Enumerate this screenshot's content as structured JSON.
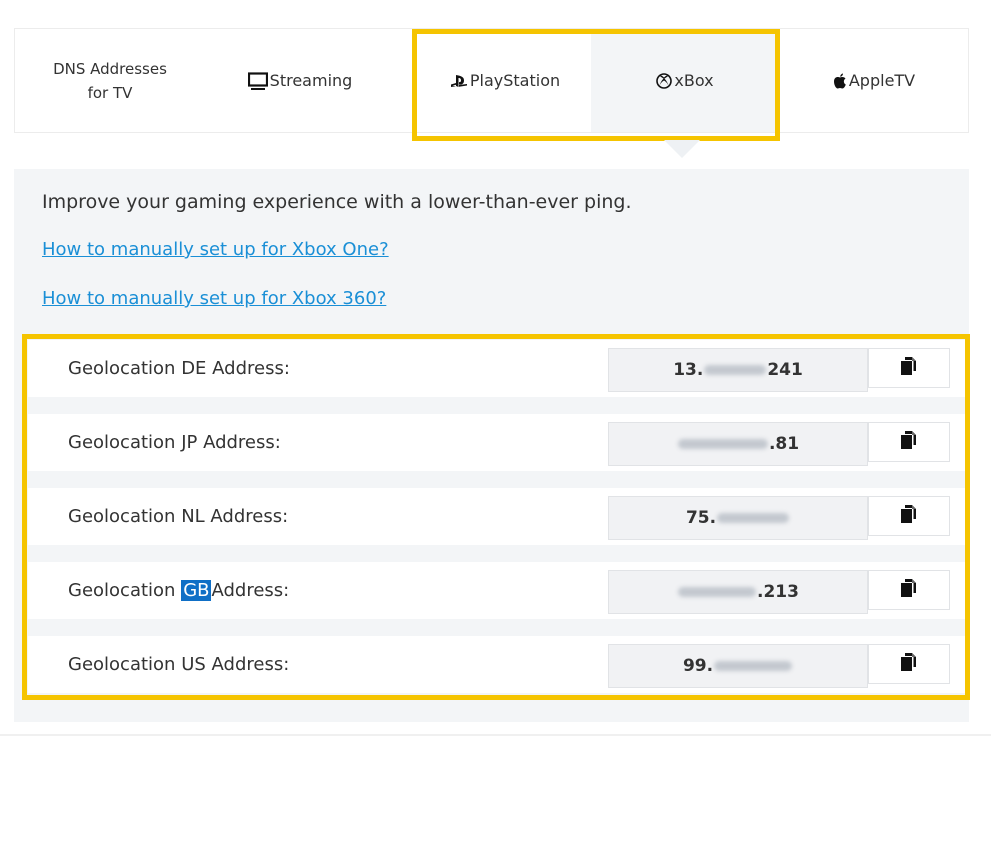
{
  "tabs": {
    "dns_line1": "DNS Addresses",
    "dns_line2": "for TV",
    "streaming": "Streaming",
    "playstation": "PlayStation",
    "xbox": "xBox",
    "appletv": "AppleTV"
  },
  "panel": {
    "intro": "Improve your gaming experience with a lower-than-ever ping.",
    "link_xbox_one": "How to manually set up for Xbox One?",
    "link_xbox_360": "How to manually set up for Xbox 360?"
  },
  "rows": [
    {
      "prefix": "Geolocation ",
      "code": "DE",
      "suffix": " Address:",
      "addr_start": "13.",
      "addr_end": "241"
    },
    {
      "prefix": "Geolocation ",
      "code": "JP",
      "suffix": " Address:",
      "addr_start": "",
      "addr_end": ".81"
    },
    {
      "prefix": "Geolocation ",
      "code": "NL",
      "suffix": " Address:",
      "addr_start": "75.",
      "addr_end": ""
    },
    {
      "prefix": "Geolocation ",
      "code": "GB",
      "suffix": "Address:",
      "addr_start": "",
      "addr_end": ".213"
    },
    {
      "prefix": "Geolocation ",
      "code": "US",
      "suffix": " Address:",
      "addr_start": "99.",
      "addr_end": ""
    }
  ],
  "colors": {
    "highlight": "#f5c400",
    "link": "#1a8fd6",
    "selection": "#0f6fc6"
  },
  "icons": {
    "streaming": "monitor-icon",
    "playstation": "playstation-logo-icon",
    "xbox": "xbox-logo-icon",
    "appletv": "apple-logo-icon",
    "copy": "copy-icon"
  }
}
